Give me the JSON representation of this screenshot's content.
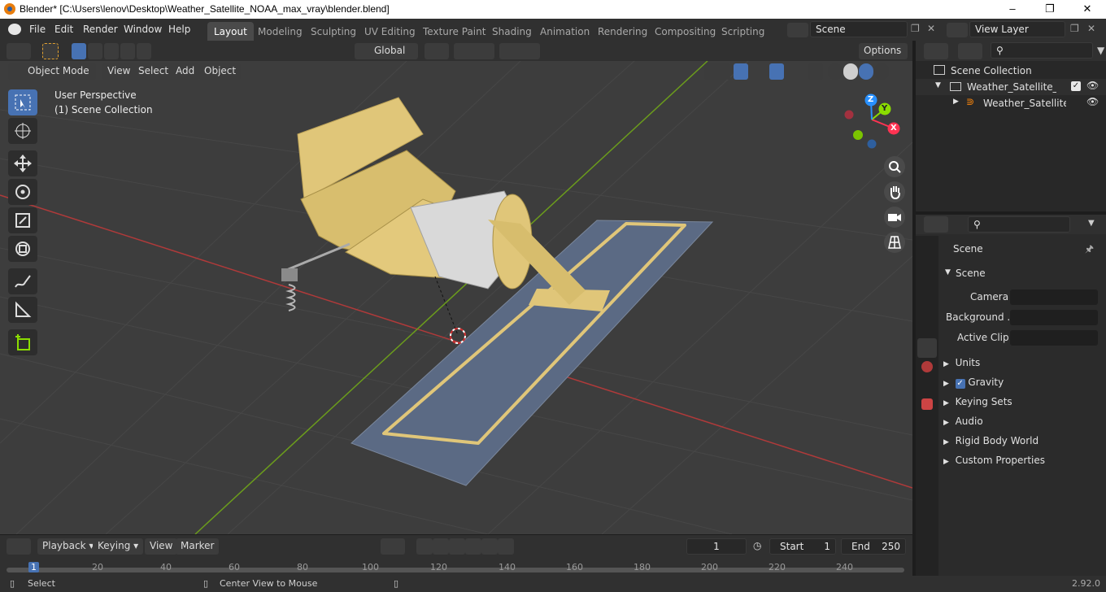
{
  "window": {
    "title": "Blender* [C:\\Users\\lenov\\Desktop\\Weather_Satellite_NOAA_max_vray\\blender.blend]"
  },
  "menu": [
    "File",
    "Edit",
    "Render",
    "Window",
    "Help"
  ],
  "workspaces": [
    "Layout",
    "Modeling",
    "Sculpting",
    "UV Editing",
    "Texture Paint",
    "Shading",
    "Animation",
    "Rendering",
    "Compositing",
    "Scripting"
  ],
  "scene_field": "Scene",
  "view_layer_field": "View Layer",
  "tool_header": {
    "orientation": "Global",
    "options": "Options"
  },
  "viewport_header": {
    "mode": "Object Mode",
    "view": "View",
    "select": "Select",
    "add": "Add",
    "object": "Object"
  },
  "viewport": {
    "perspective": "User Perspective",
    "collection": "(1) Scene Collection"
  },
  "gizmo": {
    "x": "X",
    "y": "Y",
    "z": "Z"
  },
  "colors": {
    "accent": "#4772b3",
    "x_axis": "#ff3352",
    "y_axis": "#8bdc00",
    "z_axis": "#2890ff",
    "grid_x": "#b03a3a",
    "grid_y": "#6b9c1c",
    "mesh": "#e0c679",
    "panel": "#5b6a84"
  },
  "outliner": {
    "root": "Scene Collection",
    "items": [
      "Weather_Satellite_NOAA",
      "Weather_Satellite_N"
    ]
  },
  "properties": {
    "context": "Scene",
    "panel": "Scene",
    "fields": {
      "camera": "Camera",
      "background": "Background ...",
      "active_clip": "Active Clip"
    },
    "sections": [
      "Units",
      "Gravity",
      "Keying Sets",
      "Audio",
      "Rigid Body World",
      "Custom Properties"
    ]
  },
  "timeline": {
    "menus": [
      "Playback",
      "Keying",
      "View",
      "Marker"
    ],
    "current_frame": "1",
    "start_label": "Start",
    "start": "1",
    "end_label": "End",
    "end": "250",
    "ruler": [
      "1",
      "20",
      "40",
      "60",
      "80",
      "100",
      "120",
      "140",
      "160",
      "180",
      "200",
      "220",
      "240"
    ]
  },
  "status": {
    "select": "Select",
    "center": "Center View to Mouse",
    "version": "2.92.0"
  }
}
